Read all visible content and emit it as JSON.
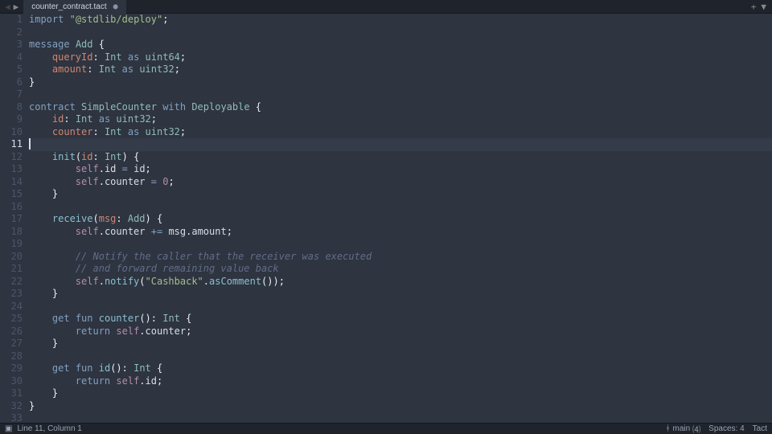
{
  "tabbar": {
    "tabs": [
      {
        "label": "counter_contract.tact",
        "dirty_glyph": "●"
      }
    ]
  },
  "editor": {
    "current_line": 11,
    "lines": [
      {
        "n": 1,
        "tokens": [
          [
            "kw",
            "import"
          ],
          [
            "punc",
            " "
          ],
          [
            "str",
            "\"@stdlib/deploy\""
          ],
          [
            "punc",
            ";"
          ]
        ]
      },
      {
        "n": 2,
        "tokens": []
      },
      {
        "n": 3,
        "tokens": [
          [
            "kw",
            "message"
          ],
          [
            "punc",
            " "
          ],
          [
            "name",
            "Add"
          ],
          [
            "punc",
            " {"
          ]
        ]
      },
      {
        "n": 4,
        "tokens": [
          [
            "punc",
            "    "
          ],
          [
            "field",
            "queryId"
          ],
          [
            "punc",
            ": "
          ],
          [
            "type",
            "Int"
          ],
          [
            "punc",
            " "
          ],
          [
            "kw",
            "as"
          ],
          [
            "punc",
            " "
          ],
          [
            "type",
            "uint64"
          ],
          [
            "punc",
            ";"
          ]
        ]
      },
      {
        "n": 5,
        "tokens": [
          [
            "punc",
            "    "
          ],
          [
            "field",
            "amount"
          ],
          [
            "punc",
            ": "
          ],
          [
            "type",
            "Int"
          ],
          [
            "punc",
            " "
          ],
          [
            "kw",
            "as"
          ],
          [
            "punc",
            " "
          ],
          [
            "type",
            "uint32"
          ],
          [
            "punc",
            ";"
          ]
        ]
      },
      {
        "n": 6,
        "tokens": [
          [
            "punc",
            "}"
          ]
        ]
      },
      {
        "n": 7,
        "tokens": []
      },
      {
        "n": 8,
        "tokens": [
          [
            "kw",
            "contract"
          ],
          [
            "punc",
            " "
          ],
          [
            "name",
            "SimpleCounter"
          ],
          [
            "punc",
            " "
          ],
          [
            "kw",
            "with"
          ],
          [
            "punc",
            " "
          ],
          [
            "type",
            "Deployable"
          ],
          [
            "punc",
            " {"
          ]
        ]
      },
      {
        "n": 9,
        "tokens": [
          [
            "punc",
            "    "
          ],
          [
            "field",
            "id"
          ],
          [
            "punc",
            ": "
          ],
          [
            "type",
            "Int"
          ],
          [
            "punc",
            " "
          ],
          [
            "kw",
            "as"
          ],
          [
            "punc",
            " "
          ],
          [
            "type",
            "uint32"
          ],
          [
            "punc",
            ";"
          ]
        ]
      },
      {
        "n": 10,
        "tokens": [
          [
            "punc",
            "    "
          ],
          [
            "field",
            "counter"
          ],
          [
            "punc",
            ": "
          ],
          [
            "type",
            "Int"
          ],
          [
            "punc",
            " "
          ],
          [
            "kw",
            "as"
          ],
          [
            "punc",
            " "
          ],
          [
            "type",
            "uint32"
          ],
          [
            "punc",
            ";"
          ]
        ]
      },
      {
        "n": 11,
        "tokens": [
          [
            "cursor",
            ""
          ]
        ]
      },
      {
        "n": 12,
        "tokens": [
          [
            "punc",
            "    "
          ],
          [
            "func",
            "init"
          ],
          [
            "punc",
            "("
          ],
          [
            "field",
            "id"
          ],
          [
            "punc",
            ": "
          ],
          [
            "type",
            "Int"
          ],
          [
            "punc",
            ") {"
          ]
        ]
      },
      {
        "n": 13,
        "tokens": [
          [
            "punc",
            "        "
          ],
          [
            "self",
            "self"
          ],
          [
            "punc",
            "."
          ],
          [
            "ident",
            "id"
          ],
          [
            "punc",
            " "
          ],
          [
            "op",
            "="
          ],
          [
            "punc",
            " "
          ],
          [
            "ident",
            "id"
          ],
          [
            "punc",
            ";"
          ]
        ]
      },
      {
        "n": 14,
        "tokens": [
          [
            "punc",
            "        "
          ],
          [
            "self",
            "self"
          ],
          [
            "punc",
            "."
          ],
          [
            "ident",
            "counter"
          ],
          [
            "punc",
            " "
          ],
          [
            "op",
            "="
          ],
          [
            "punc",
            " "
          ],
          [
            "num",
            "0"
          ],
          [
            "punc",
            ";"
          ]
        ]
      },
      {
        "n": 15,
        "tokens": [
          [
            "punc",
            "    }"
          ]
        ]
      },
      {
        "n": 16,
        "tokens": []
      },
      {
        "n": 17,
        "tokens": [
          [
            "punc",
            "    "
          ],
          [
            "func",
            "receive"
          ],
          [
            "punc",
            "("
          ],
          [
            "msgv",
            "msg"
          ],
          [
            "punc",
            ": "
          ],
          [
            "name",
            "Add"
          ],
          [
            "punc",
            ") {"
          ]
        ]
      },
      {
        "n": 18,
        "tokens": [
          [
            "punc",
            "        "
          ],
          [
            "self",
            "self"
          ],
          [
            "punc",
            "."
          ],
          [
            "ident",
            "counter"
          ],
          [
            "punc",
            " "
          ],
          [
            "op",
            "+="
          ],
          [
            "punc",
            " "
          ],
          [
            "ident",
            "msg"
          ],
          [
            "punc",
            "."
          ],
          [
            "ident",
            "amount"
          ],
          [
            "punc",
            ";"
          ]
        ]
      },
      {
        "n": 19,
        "tokens": []
      },
      {
        "n": 20,
        "tokens": [
          [
            "punc",
            "        "
          ],
          [
            "cmt",
            "// Notify the caller that the receiver was executed"
          ]
        ]
      },
      {
        "n": 21,
        "tokens": [
          [
            "punc",
            "        "
          ],
          [
            "cmt",
            "// and forward remaining value back"
          ]
        ]
      },
      {
        "n": 22,
        "tokens": [
          [
            "punc",
            "        "
          ],
          [
            "self",
            "self"
          ],
          [
            "punc",
            "."
          ],
          [
            "func",
            "notify"
          ],
          [
            "punc",
            "("
          ],
          [
            "str",
            "\"Cashback\""
          ],
          [
            "punc",
            "."
          ],
          [
            "func",
            "asComment"
          ],
          [
            "punc",
            "());"
          ]
        ]
      },
      {
        "n": 23,
        "tokens": [
          [
            "punc",
            "    }"
          ]
        ]
      },
      {
        "n": 24,
        "tokens": []
      },
      {
        "n": 25,
        "tokens": [
          [
            "punc",
            "    "
          ],
          [
            "kw",
            "get"
          ],
          [
            "punc",
            " "
          ],
          [
            "kw",
            "fun"
          ],
          [
            "punc",
            " "
          ],
          [
            "func",
            "counter"
          ],
          [
            "punc",
            "(): "
          ],
          [
            "type",
            "Int"
          ],
          [
            "punc",
            " {"
          ]
        ]
      },
      {
        "n": 26,
        "tokens": [
          [
            "punc",
            "        "
          ],
          [
            "kw",
            "return"
          ],
          [
            "punc",
            " "
          ],
          [
            "self",
            "self"
          ],
          [
            "punc",
            "."
          ],
          [
            "ident",
            "counter"
          ],
          [
            "punc",
            ";"
          ]
        ]
      },
      {
        "n": 27,
        "tokens": [
          [
            "punc",
            "    }"
          ]
        ]
      },
      {
        "n": 28,
        "tokens": []
      },
      {
        "n": 29,
        "tokens": [
          [
            "punc",
            "    "
          ],
          [
            "kw",
            "get"
          ],
          [
            "punc",
            " "
          ],
          [
            "kw",
            "fun"
          ],
          [
            "punc",
            " "
          ],
          [
            "func",
            "id"
          ],
          [
            "punc",
            "(): "
          ],
          [
            "type",
            "Int"
          ],
          [
            "punc",
            " {"
          ]
        ]
      },
      {
        "n": 30,
        "tokens": [
          [
            "punc",
            "        "
          ],
          [
            "kw",
            "return"
          ],
          [
            "punc",
            " "
          ],
          [
            "self",
            "self"
          ],
          [
            "punc",
            "."
          ],
          [
            "ident",
            "id"
          ],
          [
            "punc",
            ";"
          ]
        ]
      },
      {
        "n": 31,
        "tokens": [
          [
            "punc",
            "    }"
          ]
        ]
      },
      {
        "n": 32,
        "tokens": [
          [
            "punc",
            "}"
          ]
        ]
      },
      {
        "n": 33,
        "tokens": []
      }
    ]
  },
  "status": {
    "position": "Line 11, Column 1",
    "branch": "main",
    "branch_count": "⑷",
    "spaces": "Spaces: 4",
    "language": "Tact"
  }
}
